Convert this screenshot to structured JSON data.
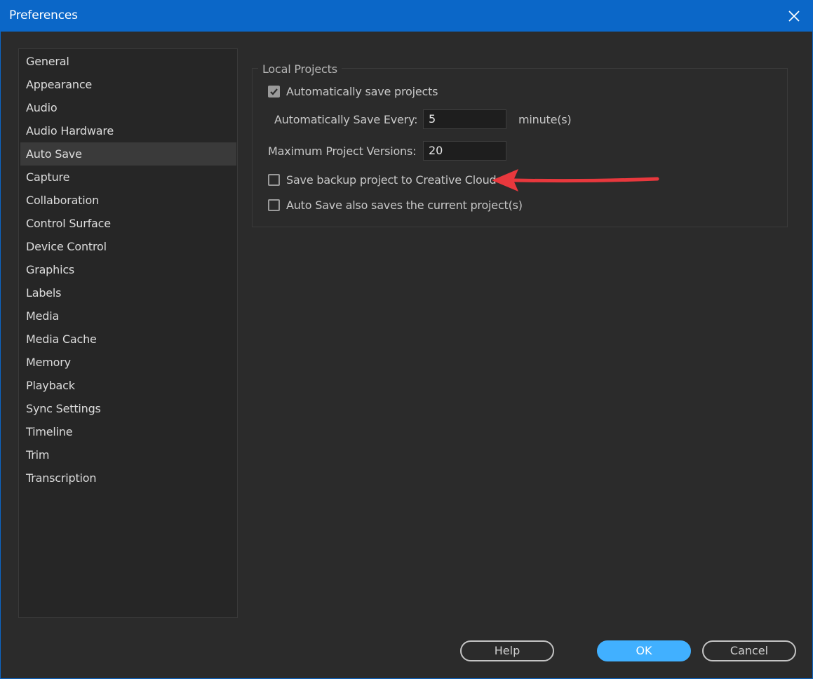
{
  "window": {
    "title": "Preferences"
  },
  "sidebar": {
    "items": [
      {
        "label": "General"
      },
      {
        "label": "Appearance"
      },
      {
        "label": "Audio"
      },
      {
        "label": "Audio Hardware"
      },
      {
        "label": "Auto Save",
        "selected": true
      },
      {
        "label": "Capture"
      },
      {
        "label": "Collaboration"
      },
      {
        "label": "Control Surface"
      },
      {
        "label": "Device Control"
      },
      {
        "label": "Graphics"
      },
      {
        "label": "Labels"
      },
      {
        "label": "Media"
      },
      {
        "label": "Media Cache"
      },
      {
        "label": "Memory"
      },
      {
        "label": "Playback"
      },
      {
        "label": "Sync Settings"
      },
      {
        "label": "Timeline"
      },
      {
        "label": "Trim"
      },
      {
        "label": "Transcription"
      }
    ]
  },
  "local_projects": {
    "legend": "Local Projects",
    "auto_save": {
      "label": "Automatically save projects",
      "checked": true
    },
    "save_every": {
      "label": "Automatically Save Every:",
      "value": "5",
      "unit": "minute(s)"
    },
    "max_versions": {
      "label": "Maximum Project Versions:",
      "value": "20"
    },
    "backup_cc": {
      "label": "Save backup project to Creative Cloud",
      "checked": false
    },
    "also_saves_current": {
      "label": "Auto Save also saves the current project(s)",
      "checked": false
    }
  },
  "buttons": {
    "help": "Help",
    "ok": "OK",
    "cancel": "Cancel"
  },
  "colors": {
    "titlebar": "#0b67c8",
    "background": "#2b2b2b",
    "primary_button": "#41b0ff",
    "annotation_arrow": "#e8383d"
  },
  "icons": {
    "close": "close-icon",
    "check": "checkmark-icon",
    "annotation": "red-arrow-annotation"
  }
}
